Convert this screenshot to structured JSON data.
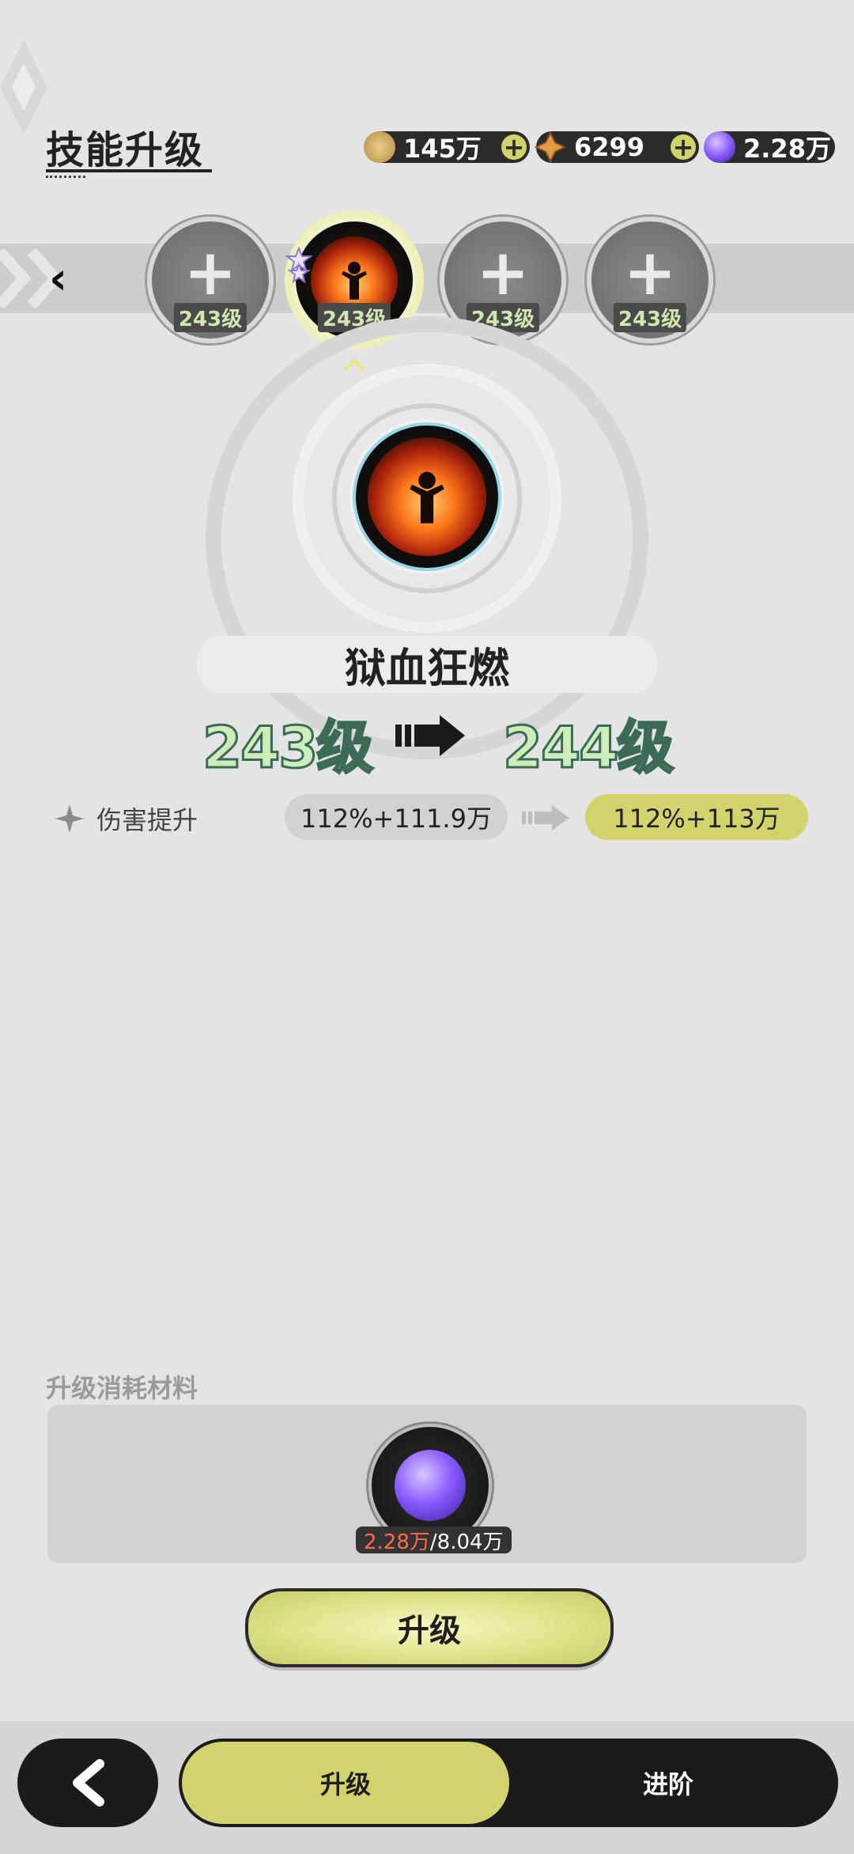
{
  "header": {
    "title": "技能升级"
  },
  "resources": [
    {
      "name": "coin",
      "icon": "coin-icon",
      "value": "145万",
      "color": "#caa35a"
    },
    {
      "name": "crystal",
      "icon": "crystal-icon",
      "value": "6299",
      "color": "#d58a3a"
    },
    {
      "name": "skill-orb",
      "icon": "skill-orb-icon",
      "value": "2.28万",
      "color": "#8a5cff"
    }
  ],
  "skill_slots": [
    {
      "level": "243级",
      "state": "empty"
    },
    {
      "level": "243级",
      "state": "selected"
    },
    {
      "level": "243级",
      "state": "empty"
    },
    {
      "level": "243级",
      "state": "empty"
    }
  ],
  "skill": {
    "name": "狱血狂燃",
    "level_current": "243级",
    "level_next": "244级"
  },
  "stat": {
    "label": "伤害提升",
    "current": "112%+111.9万",
    "next": "112%+113万"
  },
  "materials": {
    "label": "升级消耗材料",
    "have": "2.28万",
    "need": "/8.04万"
  },
  "buttons": {
    "upgrade": "升级"
  },
  "bottom_nav": {
    "tab_upgrade": "升级",
    "tab_advance": "进阶"
  },
  "colors": {
    "accent": "#d2d36d",
    "dark": "#1b1b1b",
    "insufficient": "#ff6a4a"
  }
}
